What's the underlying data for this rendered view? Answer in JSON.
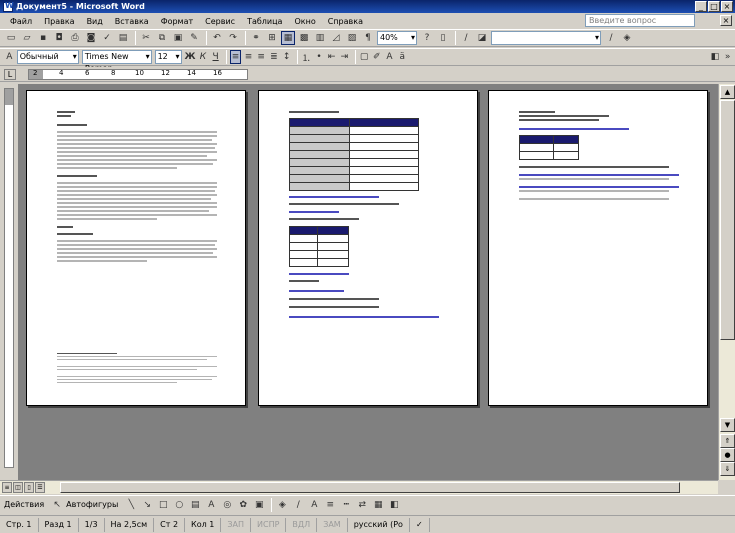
{
  "window": {
    "title": "Документ5 - Microsoft Word"
  },
  "menu": {
    "items": [
      "Файл",
      "Правка",
      "Вид",
      "Вставка",
      "Формат",
      "Сервис",
      "Таблица",
      "Окно",
      "Справка"
    ],
    "ask_placeholder": "Введите вопрос"
  },
  "toolbar": {
    "zoom": "40%"
  },
  "format": {
    "style": "Обычный",
    "font": "Times New Roman",
    "size": "12"
  },
  "ruler": {
    "marks": [
      "2",
      "4",
      "6",
      "8",
      "10",
      "12",
      "14",
      "16"
    ]
  },
  "drawing": {
    "actions_label": "Действия",
    "autoshapes_label": "Автофигуры"
  },
  "status": {
    "page": "Стр. 1",
    "section": "Разд 1",
    "pages": "1/3",
    "at": "На 2,5см",
    "line": "Ст 2",
    "col": "Кол 1",
    "rec": "ЗАП",
    "trk": "ИСПР",
    "ext": "ВДЛ",
    "ovr": "ЗАМ",
    "lang": "русский (Ро"
  },
  "colors": {
    "titlebar": "#0a246a",
    "workspace": "#808080",
    "table_header": "#1a1a6e",
    "highlight": "#ffff00"
  }
}
